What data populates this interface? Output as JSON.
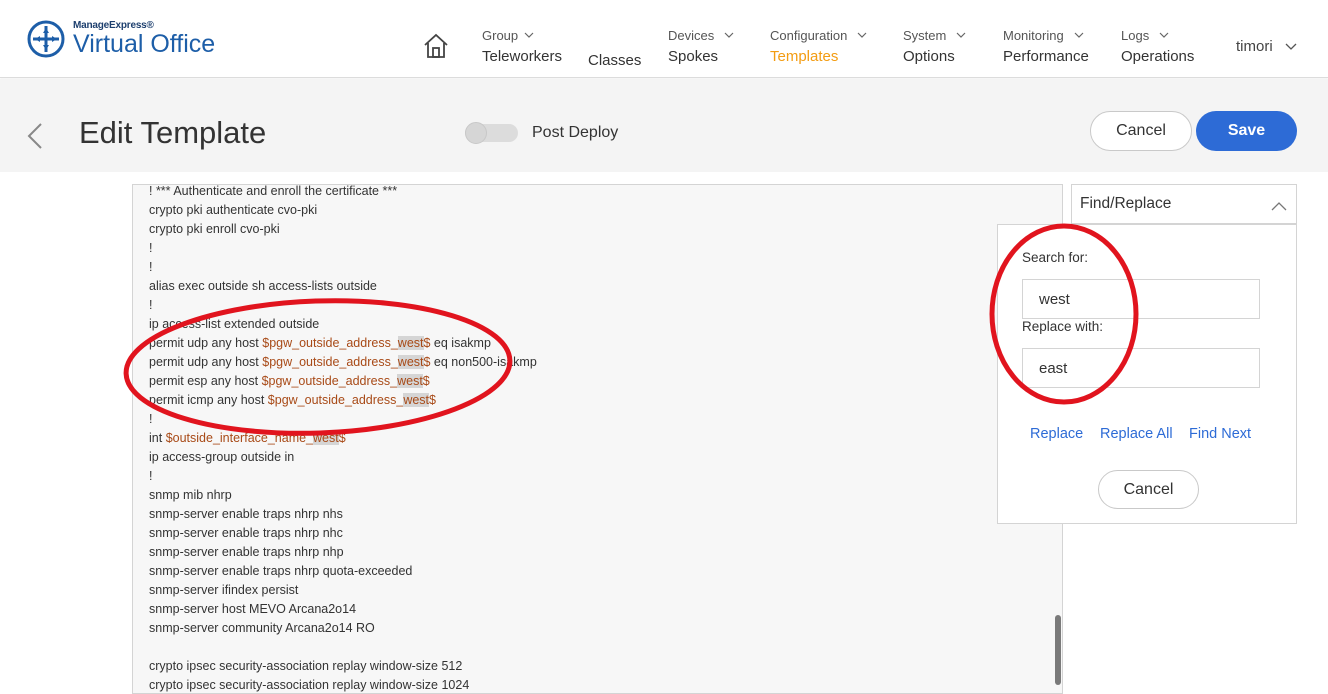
{
  "app": {
    "brand_small": "ManageExpress®",
    "brand_name": "Virtual Office"
  },
  "nav": {
    "items": [
      {
        "sup": "Group",
        "main": "Teleworkers"
      },
      {
        "sup": "",
        "main": "Classes"
      },
      {
        "sup": "Devices",
        "main": "Spokes"
      },
      {
        "sup": "Configuration",
        "main": "Templates",
        "active": true
      },
      {
        "sup": "System",
        "main": "Options"
      },
      {
        "sup": "Monitoring",
        "main": "Performance"
      },
      {
        "sup": "Logs",
        "main": "Operations"
      }
    ],
    "user": "timori"
  },
  "header": {
    "title": "Edit Template",
    "toggle_label": "Post Deploy",
    "cancel_label": "Cancel",
    "save_label": "Save"
  },
  "editor": {
    "lines": [
      [
        {
          "t": "! *** Authenticate and enroll the certificate ***"
        }
      ],
      [
        {
          "t": "crypto pki authenticate cvo-pki"
        }
      ],
      [
        {
          "t": "crypto pki enroll cvo-pki"
        }
      ],
      [
        {
          "t": "!"
        }
      ],
      [
        {
          "t": "!"
        }
      ],
      [
        {
          "t": "alias exec outside sh access-lists outside"
        }
      ],
      [
        {
          "t": "!"
        }
      ],
      [
        {
          "t": "ip access-list extended outside"
        }
      ],
      [
        {
          "t": "permit udp any host "
        },
        {
          "t": "$pgw_outside_address_",
          "v": 1
        },
        {
          "t": "west",
          "v": 1,
          "h": 1
        },
        {
          "t": "$",
          "v": 1
        },
        {
          "t": " eq isakmp"
        }
      ],
      [
        {
          "t": "permit udp any host "
        },
        {
          "t": "$pgw_outside_address_",
          "v": 1
        },
        {
          "t": "west",
          "v": 1,
          "h": 1
        },
        {
          "t": "$",
          "v": 1
        },
        {
          "t": " eq non500-isakmp"
        }
      ],
      [
        {
          "t": "permit esp any host "
        },
        {
          "t": "$pgw_outside_address_",
          "v": 1
        },
        {
          "t": "west",
          "v": 1,
          "h": 1
        },
        {
          "t": "$",
          "v": 1
        }
      ],
      [
        {
          "t": "permit icmp any host "
        },
        {
          "t": "$pgw_outside_address_",
          "v": 1
        },
        {
          "t": "west",
          "v": 1,
          "h": 1
        },
        {
          "t": "$",
          "v": 1
        }
      ],
      [
        {
          "t": "!"
        }
      ],
      [
        {
          "t": "int "
        },
        {
          "t": "$outside_interface_name_",
          "v": 1
        },
        {
          "t": "west",
          "v": 1,
          "h": 1
        },
        {
          "t": "$",
          "v": 1
        }
      ],
      [
        {
          "t": "ip access-group outside in"
        }
      ],
      [
        {
          "t": "!"
        }
      ],
      [
        {
          "t": "snmp mib nhrp"
        }
      ],
      [
        {
          "t": "snmp-server enable traps nhrp nhs"
        }
      ],
      [
        {
          "t": "snmp-server enable traps nhrp nhc"
        }
      ],
      [
        {
          "t": "snmp-server enable traps nhrp nhp"
        }
      ],
      [
        {
          "t": "snmp-server enable traps nhrp quota-exceeded"
        }
      ],
      [
        {
          "t": "snmp-server ifindex persist"
        }
      ],
      [
        {
          "t": "snmp-server host MEVO Arcana2o14"
        }
      ],
      [
        {
          "t": "snmp-server community Arcana2o14 RO"
        }
      ],
      [
        {
          "t": ""
        }
      ],
      [
        {
          "t": "crypto ipsec security-association replay window-size 512"
        }
      ],
      [
        {
          "t": "crypto ipsec security-association replay window-size 1024"
        }
      ]
    ]
  },
  "find_replace": {
    "header": "Find/Replace",
    "search_label": "Search for:",
    "search_value": "west",
    "replace_label": "Replace with:",
    "replace_value": "east",
    "replace_link": "Replace",
    "replace_all_link": "Replace All",
    "find_next_link": "Find Next",
    "cancel_label": "Cancel"
  },
  "colors": {
    "accent_active": "#f39c12",
    "primary_button": "#2d6bd6",
    "variable_text": "#a84a17",
    "annotation_red": "#e1141e"
  }
}
